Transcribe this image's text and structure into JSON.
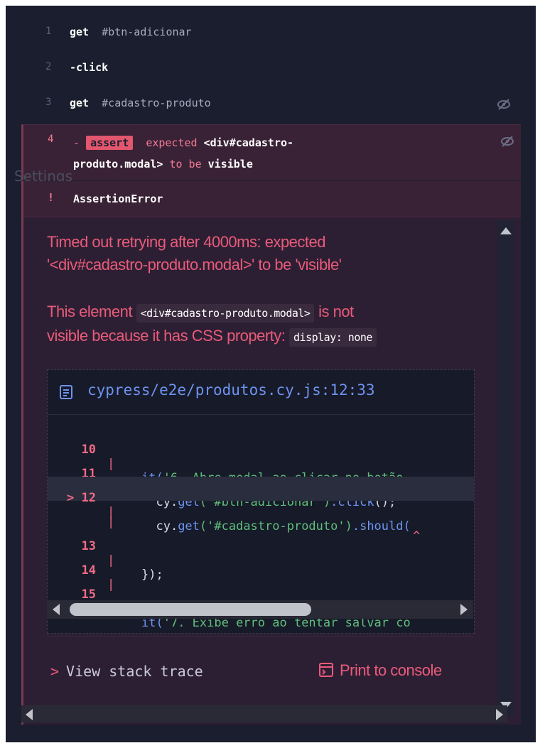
{
  "commands": [
    {
      "num": "1",
      "cmd": "get",
      "arg": "#btn-adicionar"
    },
    {
      "num": "2",
      "cmd": "-click",
      "arg": ""
    },
    {
      "num": "3",
      "cmd": "get",
      "arg": "#cadastro-produto"
    }
  ],
  "failed": {
    "num": "4",
    "dash": "-",
    "badge": "assert",
    "line1": "expected",
    "subject1": "<div#cadastro-",
    "subject2": "produto.modal>",
    "to_be": "to be",
    "visible": "visible"
  },
  "ghost_label": "Settings",
  "error": {
    "bang": "!",
    "name": "AssertionError",
    "message_line1": "Timed out retrying after 4000ms: expected",
    "message_line2": "'<div#cadastro-produto.modal>' to be 'visible'",
    "detail_pre": "This element",
    "detail_code": "<div#cadastro-produto.modal>",
    "detail_mid": "is not",
    "detail_line2": "visible because it has CSS property:",
    "detail_code2": "display: none"
  },
  "code_frame": {
    "file": "cypress/e2e/produtos.cy.js:12:33",
    "lines": [
      {
        "n": "10",
        "pre": "it(",
        "s": "'6. Abre modal ao clicar no botão",
        "post": ""
      },
      {
        "n": "11",
        "pre": "  cy.",
        "fn": "get",
        "s": "('#btn-adicionar')",
        "fn2": ".click",
        "post": "();"
      },
      {
        "n": "12",
        "pre": "  cy.",
        "fn": "get",
        "s": "('#cadastro-produto')",
        "fn2": ".should(",
        "post": ""
      },
      {
        "n": "13",
        "pre": "});",
        "s": "",
        "post": ""
      },
      {
        "n": "14",
        "pre": "",
        "s": "",
        "post": ""
      },
      {
        "n": "15",
        "pre": "it(",
        "s": "'7. Exibe erro ao tentar salvar co",
        "post": ""
      }
    ],
    "marker": ">",
    "caret": "^"
  },
  "actions": {
    "stack_chevron": ">",
    "stack_label": "View stack trace",
    "print_label": "Print to console"
  },
  "colors": {
    "panel_bg": "#1b1e2e",
    "error_bg": "#2d1f33",
    "error_accent": "#e95b7a",
    "link_blue": "#6d93f0"
  }
}
